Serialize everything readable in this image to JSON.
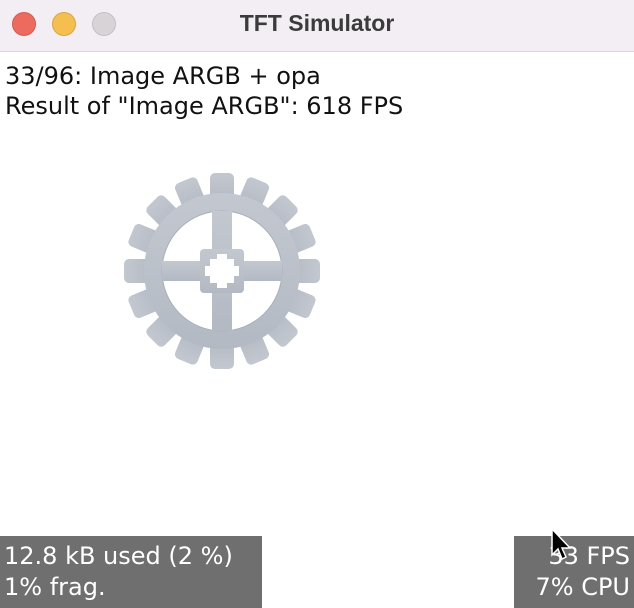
{
  "window": {
    "title": "TFT Simulator"
  },
  "benchmark": {
    "progress_line": "33/96: Image ARGB + opa",
    "result_line": "Result of \"Image ARGB\": 618 FPS"
  },
  "gear_image": {
    "icon": "gear-icon",
    "color": "#c7ccd4"
  },
  "monitor": {
    "memory_used": "12.8 kB used (2 %)",
    "fragmentation": "1% frag.",
    "fps": "33 FPS",
    "cpu": "7% CPU"
  },
  "colors": {
    "close": "#ed6a5e",
    "minimize": "#f5bf4f",
    "maximize": "#d7d3d7",
    "overlay_bg": "#6f6f6f"
  }
}
